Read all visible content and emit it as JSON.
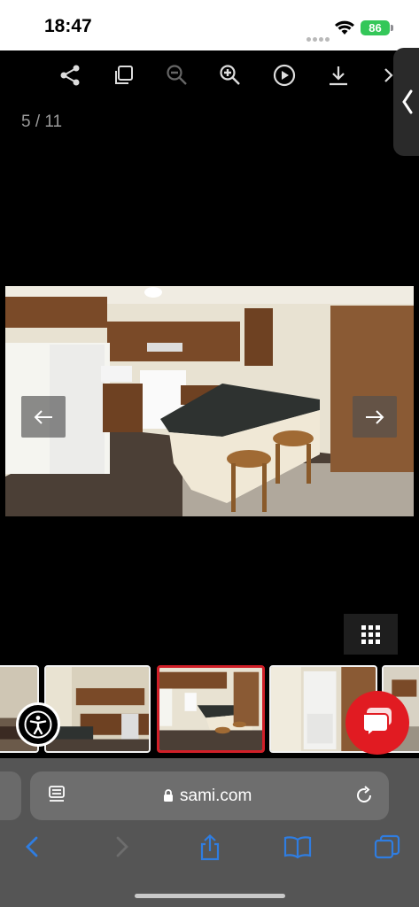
{
  "status_bar": {
    "time": "18:47",
    "battery": "86"
  },
  "viewer": {
    "counter": "5 / 11",
    "toolbar": [
      "share-icon",
      "copy-icon",
      "zoom-out-icon",
      "zoom-in-icon",
      "play-icon",
      "download-icon",
      "chevron-right-icon"
    ]
  },
  "browser": {
    "url": "sami.com"
  },
  "colors": {
    "accent_red": "#d01f28",
    "battery_green": "#34c759",
    "link_blue": "#2f7de1"
  }
}
